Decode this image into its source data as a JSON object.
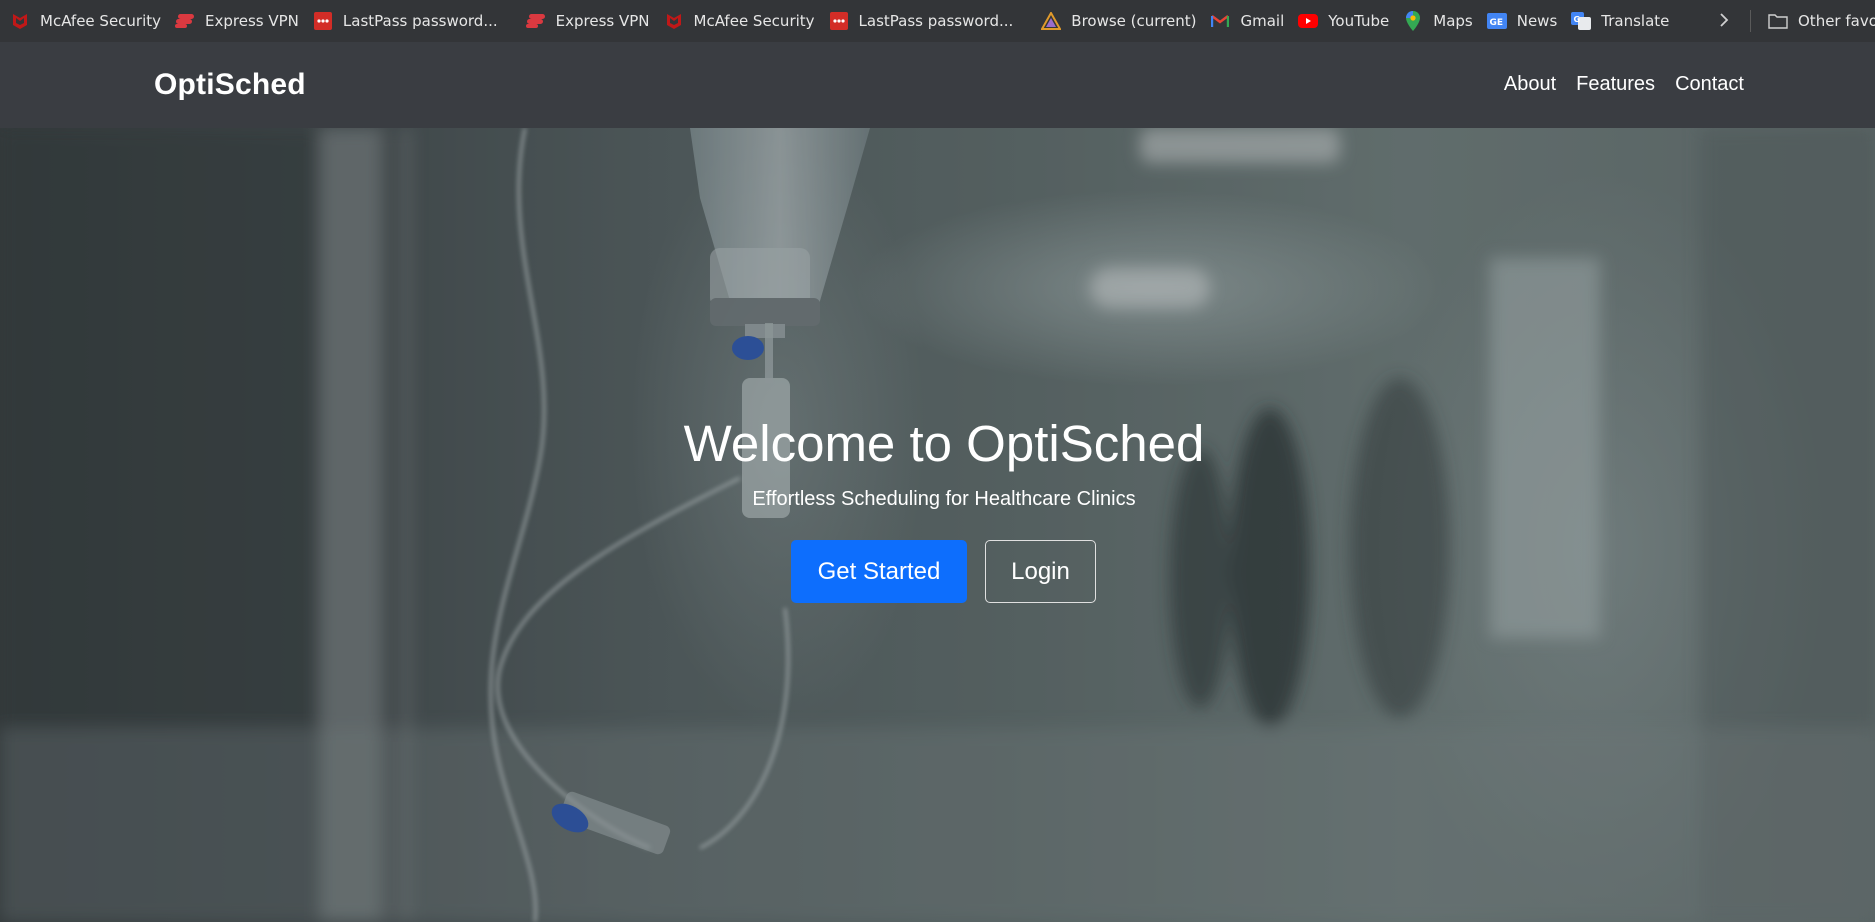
{
  "bookmarks_bar": {
    "items": [
      {
        "label": "McAfee Security",
        "icon": "mcafee-icon",
        "color": "#c01818"
      },
      {
        "label": "Express VPN",
        "icon": "expressvpn-icon",
        "color": "#da3940"
      },
      {
        "label": "LastPass password...",
        "icon": "lastpass-icon",
        "color": "#d32d27"
      },
      {
        "label": "Express VPN",
        "icon": "expressvpn-icon",
        "color": "#da3940"
      },
      {
        "label": "McAfee Security",
        "icon": "mcafee-icon",
        "color": "#c01818"
      },
      {
        "label": "LastPass password...",
        "icon": "lastpass-icon",
        "color": "#d32d27"
      },
      {
        "label": "Browse (current)",
        "icon": "browse-icon",
        "color": "#e09a2b"
      },
      {
        "label": "Gmail",
        "icon": "gmail-icon",
        "color": "#ea4335"
      },
      {
        "label": "YouTube",
        "icon": "youtube-icon",
        "color": "#ff0000"
      },
      {
        "label": "Maps",
        "icon": "maps-icon",
        "color": "#34a853"
      },
      {
        "label": "News",
        "icon": "news-icon",
        "color": "#4285f4"
      },
      {
        "label": "Translate",
        "icon": "translate-icon",
        "color": "#4285f4"
      }
    ],
    "other_favorites": "Other favorites"
  },
  "navbar": {
    "brand": "OptiSched",
    "links": [
      "About",
      "Features",
      "Contact"
    ]
  },
  "hero": {
    "title": "Welcome to OptiSched",
    "subtitle": "Effortless Scheduling for Healthcare Clinics",
    "primary_button": "Get Started",
    "secondary_button": "Login"
  },
  "colors": {
    "primary": "#0d6efd",
    "navbar_bg": "#3a3d42",
    "bookmarks_bg": "#333538"
  }
}
